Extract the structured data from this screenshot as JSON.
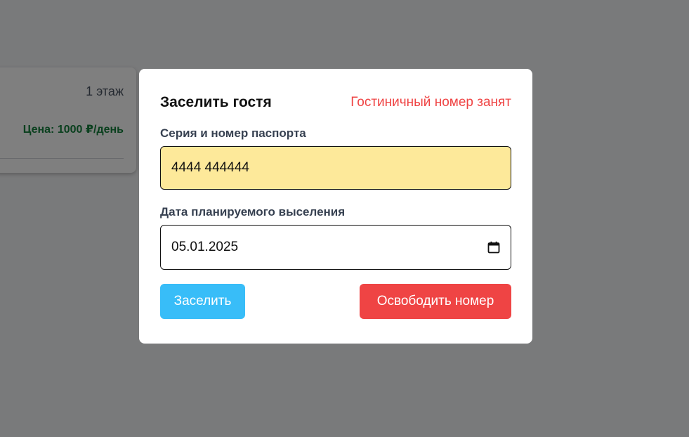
{
  "background": {
    "room_card": {
      "floor": "1 этаж",
      "price": "Цена: 1000 ₽/день"
    }
  },
  "modal": {
    "title": "Заселить гостя",
    "status": "Гостиничный номер занят",
    "passport_label": "Серия и номер паспорта",
    "passport_value": "4444 444444",
    "checkout_label": "Дата планируемого выселения",
    "checkout_value": "05.01.2025",
    "checkin_button": "Заселить",
    "free_button": "Освободить номер"
  },
  "colors": {
    "accent_blue": "#38bdf8",
    "danger_red": "#ef4444",
    "input_highlight": "#fde99a",
    "price_green": "#15803d"
  },
  "icons": {
    "date_picker": "calendar-icon"
  }
}
